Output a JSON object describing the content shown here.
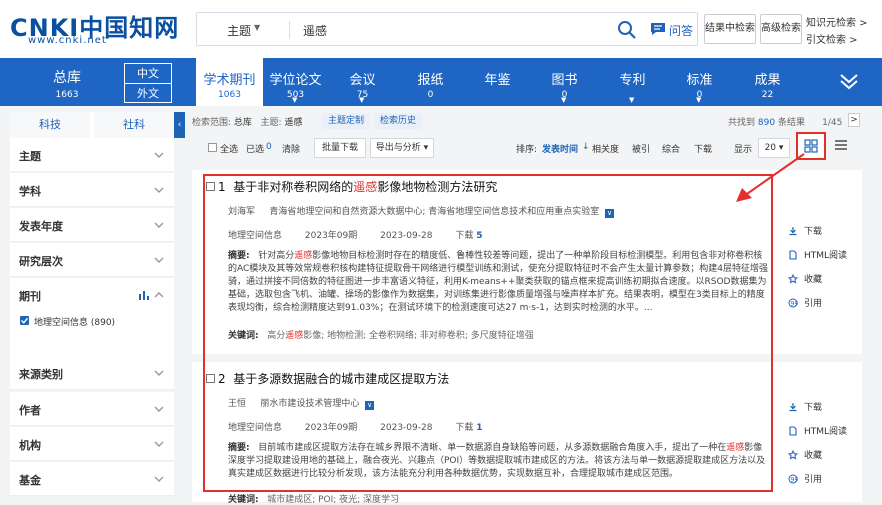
{
  "header": {
    "logo_text": "CNKI中国知网",
    "logo_url": "www.cnki.net",
    "search_field": "主题",
    "search_value": "遥感",
    "qa_label": "问答",
    "btn_in_results": "结果中检索",
    "btn_advanced": "高级检索",
    "link_knowledge": "知识元检索 >",
    "link_citation": "引文检索 >"
  },
  "db_band": {
    "all": {
      "label": "总库",
      "count": "1663"
    },
    "lang_cn": "中文",
    "lang_en": "外文",
    "tabs": [
      {
        "label": "学术期刊",
        "count": "1063",
        "active": true
      },
      {
        "label": "学位论文",
        "count": "503"
      },
      {
        "label": "会议",
        "count": "75"
      },
      {
        "label": "报纸",
        "count": "0"
      },
      {
        "label": "年鉴",
        "count": ""
      },
      {
        "label": "图书",
        "count": "0"
      },
      {
        "label": "专利",
        "count": ""
      },
      {
        "label": "标准",
        "count": "0"
      },
      {
        "label": "成果",
        "count": "22"
      }
    ]
  },
  "sidebar": {
    "tabs": [
      "科技",
      "社科"
    ],
    "facets": [
      "主题",
      "学科",
      "发表年度",
      "研究层次",
      "期刊",
      "来源类别",
      "作者",
      "机构",
      "基金"
    ],
    "journal_item": "地理空间信息 (890)"
  },
  "results_bar": {
    "scope_label": "检索范围:",
    "scope_value": "总库",
    "topic_label": "主题:",
    "topic_value": "遥感",
    "btn_topic_custom": "主题定制",
    "btn_history": "检索历史",
    "found_prefix": "共找到",
    "found_count": "890",
    "found_suffix": "条结果",
    "page": "1/45",
    "next": ">"
  },
  "toolbar": {
    "select_all": "全选",
    "selected": "已选",
    "selected_count": "0",
    "clear": "清除",
    "batch_download": "批量下载",
    "export": "导出与分析",
    "sort_label": "排序:",
    "sort_options": [
      "发表时间",
      "相关度",
      "被引",
      "综合",
      "下载"
    ],
    "show_label": "显示",
    "show_value": "20"
  },
  "results": [
    {
      "index": "1",
      "title_before": "基于非对称卷积网络的",
      "title_hl": "遥感",
      "title_after": "影像地物检测方法研究",
      "author": "刘海军",
      "affiliation": "青海省地理空间和自然资源大数据中心; 青海省地理空间信息技术和应用重点实验室",
      "source": "地理空间信息",
      "issue": "2023年09期",
      "date": "2023-09-28",
      "download_label": "下载",
      "download_count": "5",
      "abstract_label": "摘要:",
      "abstract_before": "针对高分",
      "abstract_hl": "遥感",
      "abstract_after": "影像地物目标检测时存在的精度低、鲁棒性较差等问题，提出了一种单阶段目标检测模型。利用包含非对称卷积核的AC模块及其等效常规卷积核构建特征提取骨干网络进行模型训练和测试，使充分提取特征时不会产生太量计算参数；构建4层特征增强骑，通过拼接不同倍数的特征图进一步丰富语义特征，利用K-means++聚类获取的锚点框来提高训练初期拟合速度。以RSOD数据集为基础，选取包含飞机、油罐、操场的影像作为数据集，对训练集进行影像质量增强与噪声样本扩充。结果表明，模型在3类目标上的精度表现均衡，综合检测精度达到91.03%；在测试环境下的检测速度可达27 m·s-1，达到实时检测的水平。...",
      "keywords_label": "关键词:",
      "keywords_before": "高分",
      "keywords_hl": "遥感",
      "keywords_after": "影像;  地物检测;  全卷积网络;  非对称卷积;  多尺度特征增强"
    },
    {
      "index": "2",
      "title_before": "基于多源数据融合的城市建成区提取方法",
      "title_hl": "",
      "title_after": "",
      "author": "王恒",
      "affiliation": "丽水市建设技术管理中心",
      "source": "地理空间信息",
      "issue": "2023年09期",
      "date": "2023-09-28",
      "download_label": "下载",
      "download_count": "1",
      "abstract_label": "摘要:",
      "abstract_before": "目前城市建成区提取方法存在城乡界限不清晰、单一数据源自身缺陷等问题，从多源数据融合角度入手，提出了一种在",
      "abstract_hl": "遥感",
      "abstract_after": "影像深度学习提取建设用地的基础上，融合夜光、兴趣点（POI）等数据提取城市建成区的方法。将该方法与单一数据源提取建成区方法以及真实建成区数据进行比较分析发现，该方法能充分利用各种数据优势，实现数据互补，合理提取城市建成区范围。",
      "keywords_label": "关键词:",
      "keywords_before": "城市建成区;  POI;  夜光;  深度学习",
      "keywords_hl": "",
      "keywords_after": ""
    }
  ],
  "actions": [
    "下载",
    "HTML阅读",
    "收藏",
    "引用"
  ],
  "colors": {
    "brand_blue": "#1f65c4",
    "link_blue": "#1e63b7",
    "highlight_red": "#e3302b"
  }
}
